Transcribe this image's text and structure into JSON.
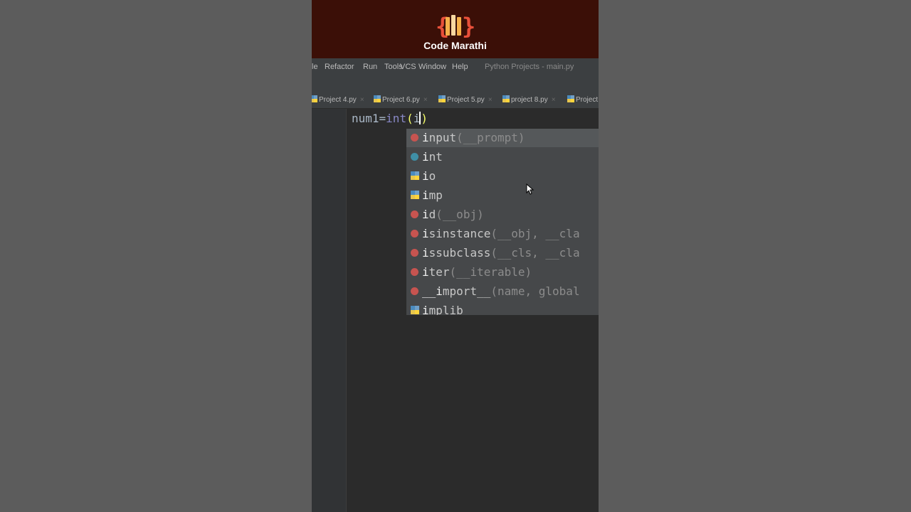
{
  "brand": {
    "name": "Code Marathi"
  },
  "menu": {
    "items": [
      "le",
      "Refactor",
      "Run",
      "Tools",
      "VCS",
      "Window",
      "Help"
    ],
    "title": "Python Projects - main.py"
  },
  "tabs": [
    "Project 4.py",
    "Project 6.py",
    "Project 5.py",
    "project 8.py",
    "Project"
  ],
  "editor": {
    "code_prefix": "num1=",
    "code_fn": "int",
    "code_open": "(",
    "code_typed": "i",
    "code_close": ")"
  },
  "completion": {
    "items": [
      {
        "icon": "function",
        "match": "i",
        "rest": "nput",
        "args": "(__prompt)"
      },
      {
        "icon": "class",
        "match": "i",
        "rest": "nt",
        "args": ""
      },
      {
        "icon": "module",
        "match": "i",
        "rest": "o",
        "args": ""
      },
      {
        "icon": "module",
        "match": "i",
        "rest": "mp",
        "args": ""
      },
      {
        "icon": "function",
        "match": "i",
        "rest": "d",
        "args": "(__obj)"
      },
      {
        "icon": "function",
        "match": "i",
        "rest": "sinstance",
        "args": "(__obj, __cla"
      },
      {
        "icon": "function",
        "match": "i",
        "rest": "ssubclass",
        "args": "(__cls, __cla"
      },
      {
        "icon": "function",
        "match": "i",
        "rest": "ter",
        "args": "(__iterable)"
      },
      {
        "icon": "function",
        "match": "__i",
        "rest": "mport__",
        "args": "(name, global"
      },
      {
        "icon": "module",
        "match": "i",
        "rest": "mplib",
        "args": ""
      }
    ]
  },
  "colors": {
    "banner": "#3b0f07",
    "editor_bg": "#2b2b2b",
    "popup_bg": "#46484a",
    "function_icon": "#c75450",
    "class_icon": "#3f8fa6"
  }
}
